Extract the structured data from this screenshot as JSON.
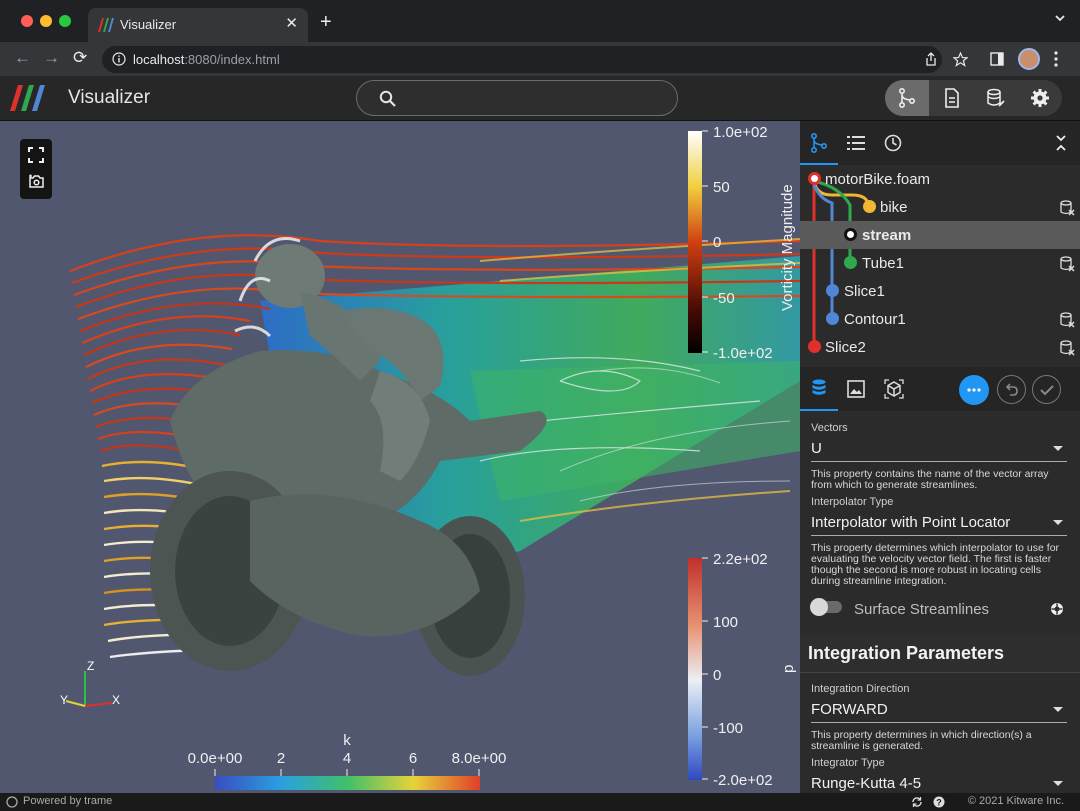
{
  "browser": {
    "tab_title": "Visualizer",
    "url_host": "localhost",
    "url_rest": ":8080/index.html"
  },
  "app": {
    "title": "Visualizer",
    "search_placeholder": ""
  },
  "viewport": {
    "colorbars": [
      {
        "title": "Vorticity Magnitude",
        "ticks": [
          "1.0e+02",
          "50",
          "0",
          "-50",
          "-1.0e+02"
        ]
      },
      {
        "title": "p",
        "ticks": [
          "2.2e+02",
          "100",
          "0",
          "-100",
          "-2.0e+02"
        ]
      },
      {
        "title": "k",
        "ticks": [
          "0.0e+00",
          "2",
          "4",
          "6",
          "8.0e+00"
        ]
      }
    ],
    "axes": {
      "z": "Z",
      "y": "Y",
      "x": "X"
    }
  },
  "pipeline": {
    "items": [
      {
        "label": "motorBike.foam",
        "color": "#e0302b",
        "bold": false
      },
      {
        "label": "bike",
        "color": "#f2b632",
        "bold": false
      },
      {
        "label": "stream",
        "color": "#ffffff",
        "bold": true
      },
      {
        "label": "Tube1",
        "color": "#2fa84f",
        "bold": false
      },
      {
        "label": "Slice1",
        "color": "#4f86d6",
        "bold": false
      },
      {
        "label": "Contour1",
        "color": "#4f86d6",
        "bold": false
      },
      {
        "label": "Slice2",
        "color": "#e0302b",
        "bold": false
      }
    ]
  },
  "properties": {
    "vectors": {
      "label": "Vectors",
      "value": "U",
      "help": "This property contains the name of the vector array from which to generate streamlines."
    },
    "interpolator": {
      "label": "Interpolator Type",
      "value": "Interpolator with Point Locator",
      "help": "This property determines which interpolator to use for evaluating the velocity vector field. The first is faster though the second is more robust in locating cells during streamline integration."
    },
    "surface_streamlines": {
      "label": "Surface Streamlines",
      "checked": false
    },
    "section_title": "Integration Parameters",
    "direction": {
      "label": "Integration Direction",
      "value": "FORWARD",
      "help": "This property determines in which direction(s) a streamline is generated."
    },
    "integrator": {
      "label": "Integrator Type",
      "value": "Runge-Kutta 4-5"
    }
  },
  "status": {
    "left": "Powered by trame",
    "right": "© 2021 Kitware Inc."
  },
  "colors": {
    "accent": "#2196f3",
    "viewport_bg": "#525770",
    "panel_bg": "#2b2b2b"
  }
}
